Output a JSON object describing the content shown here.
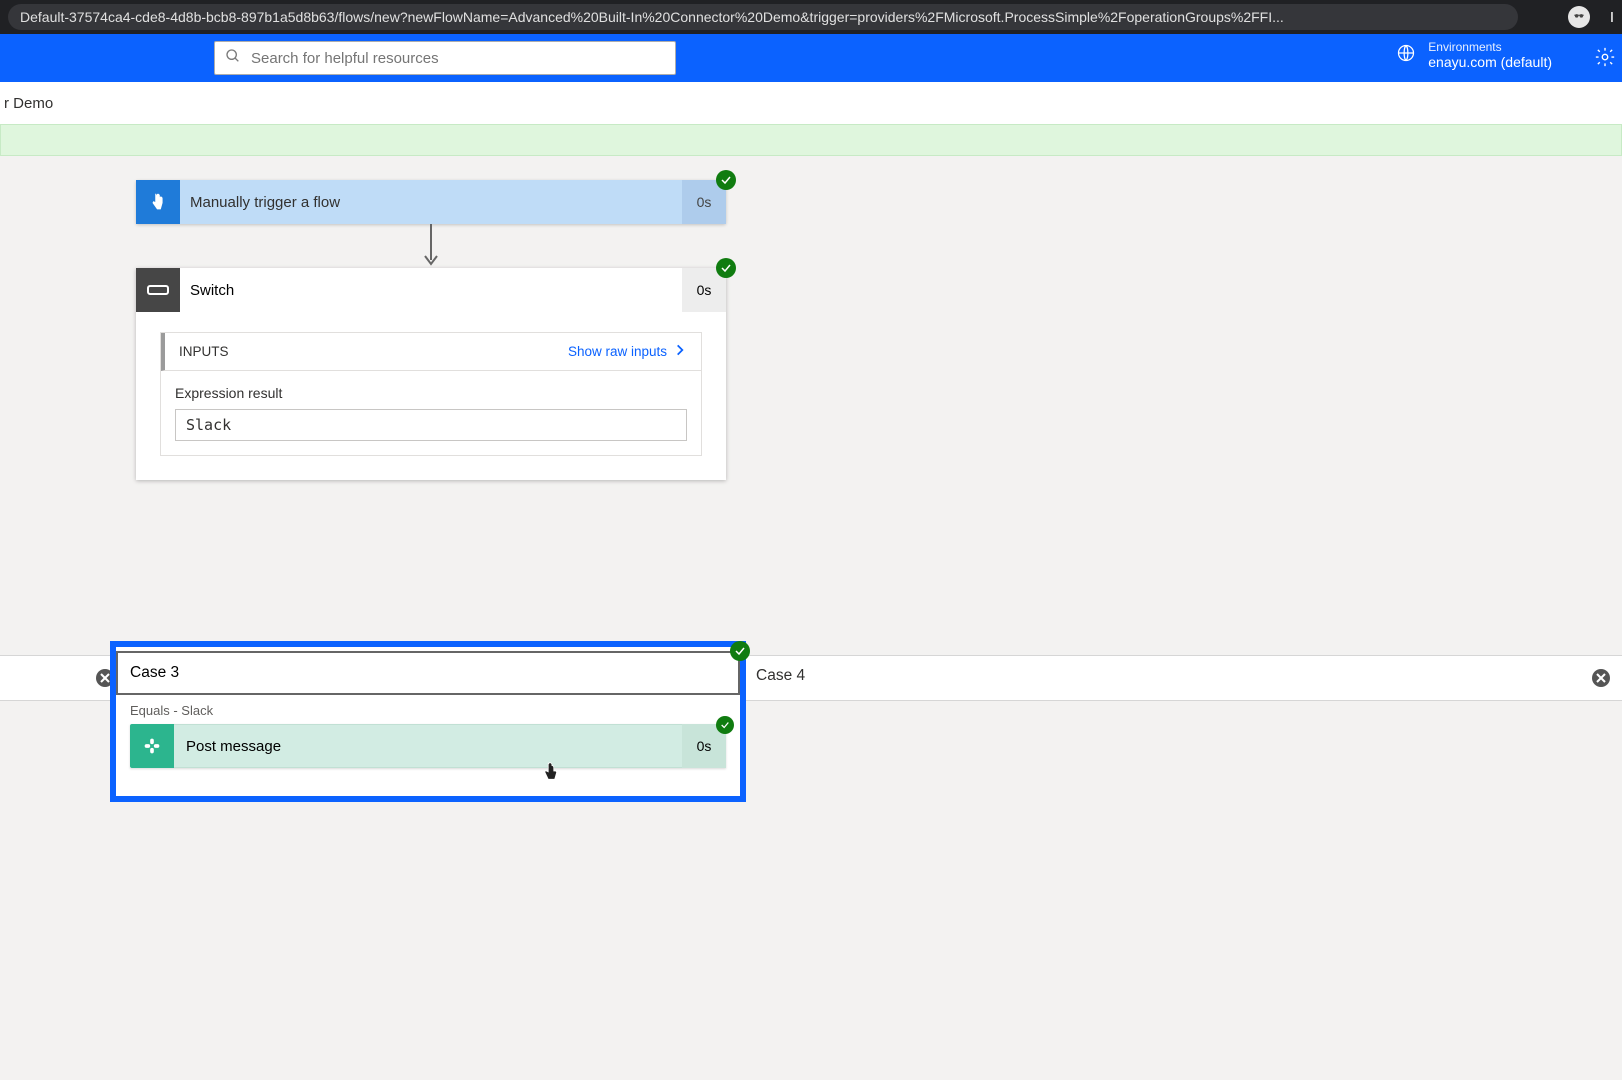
{
  "browser": {
    "url": "Default-37574ca4-cde8-4d8b-bcb8-897b1a5d8b63/flows/new?newFlowName=Advanced%20Built-In%20Connector%20Demo&trigger=providers%2FMicrosoft.ProcessSimple%2FoperationGroups%2FFI...",
    "profile_truncated": "I"
  },
  "header": {
    "search_placeholder": "Search for helpful resources",
    "env_label": "Environments",
    "env_value": "enayu.com (default)"
  },
  "subheader": {
    "title_fragment": "r Demo"
  },
  "flow": {
    "trigger": {
      "title": "Manually trigger a flow",
      "duration": "0s"
    },
    "switch": {
      "title": "Switch",
      "duration": "0s",
      "inputs_label": "INPUTS",
      "raw_link": "Show raw inputs",
      "expression_label": "Expression result",
      "expression_value": "Slack"
    },
    "cases": {
      "selected": {
        "title": "Case 3",
        "equals": "Equals - Slack",
        "action": {
          "title": "Post message",
          "duration": "0s"
        }
      },
      "other": {
        "title": "Case 4"
      }
    }
  }
}
